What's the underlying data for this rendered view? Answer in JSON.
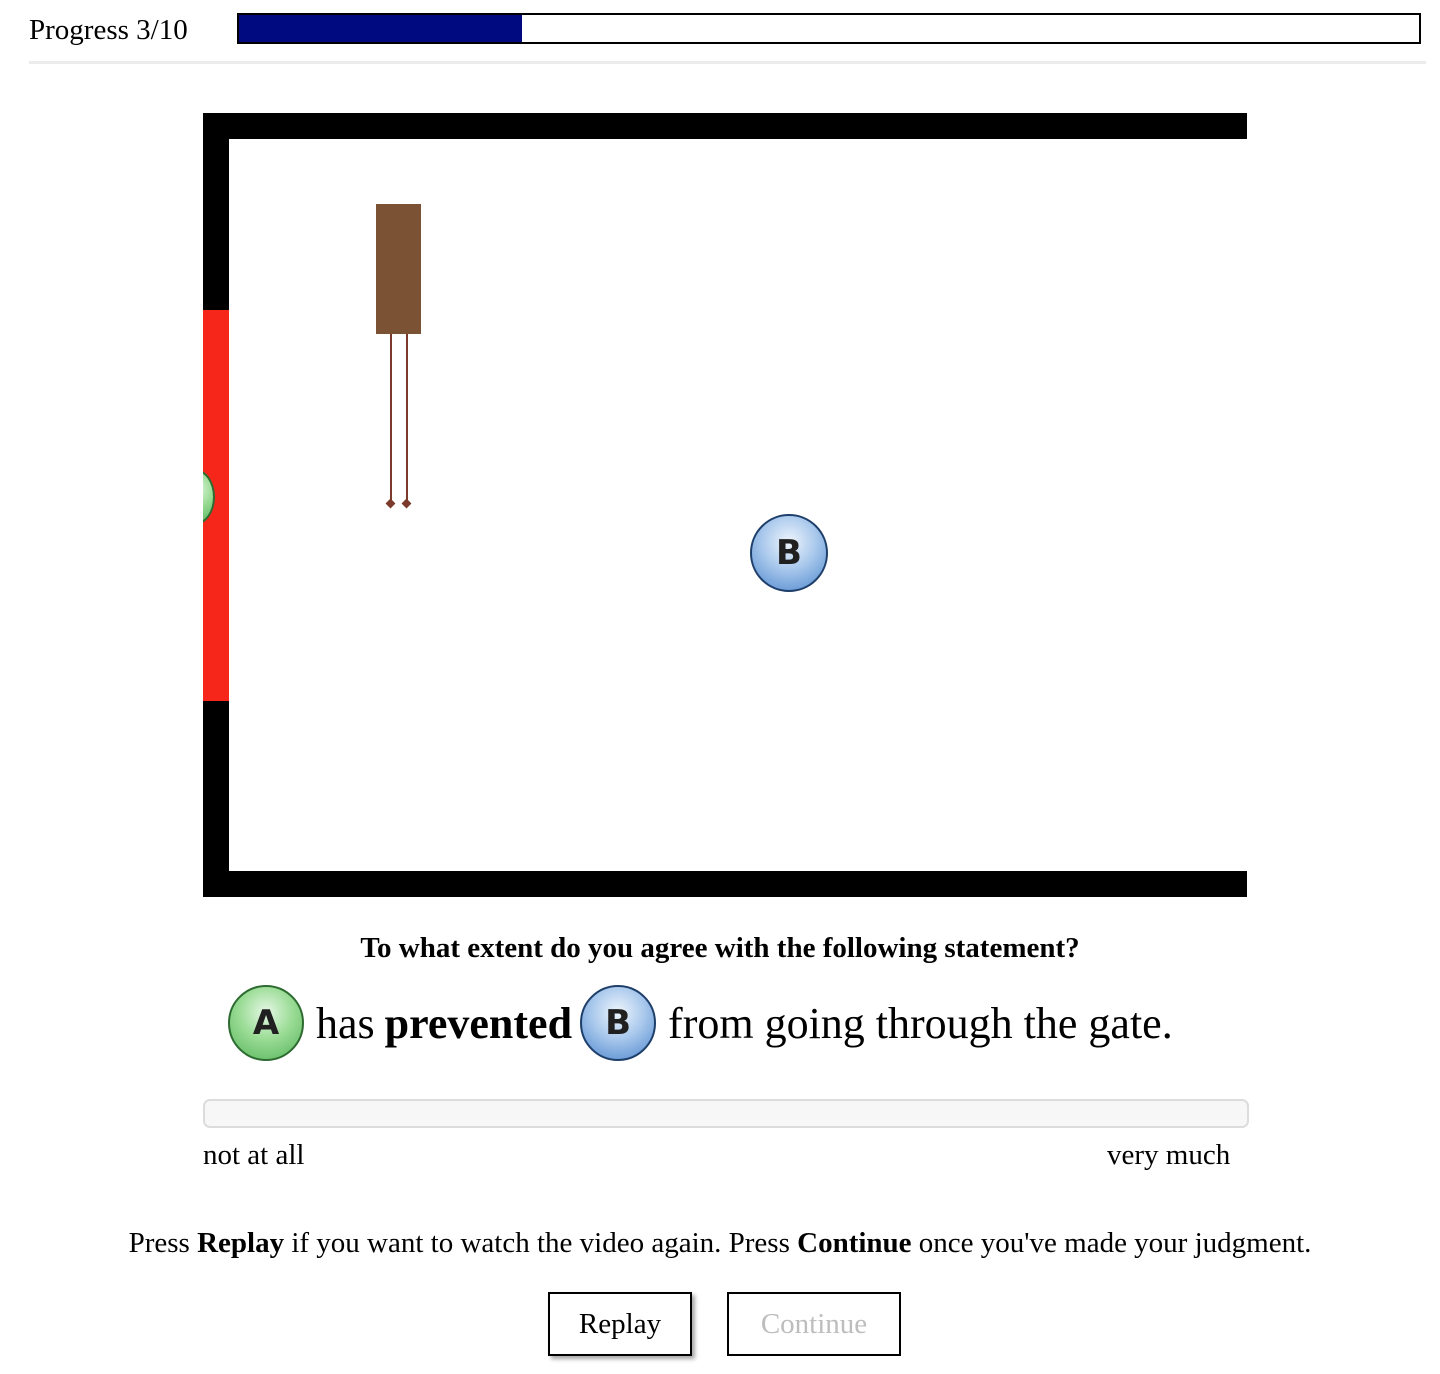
{
  "progress": {
    "label": "Progress 3/10",
    "current": 3,
    "total": 10,
    "fill_fraction": 0.24,
    "fill_color": "#000a80"
  },
  "stage": {
    "gate_color": "#f7261b",
    "ball_a_label": "A",
    "ball_b_label": "B",
    "box_color": "#7b5233"
  },
  "question": {
    "prompt": "To what extent do you agree with the following statement?",
    "statement": {
      "subject": "A",
      "has": "has",
      "verb": "prevented",
      "object": "B",
      "rest": "from going through the gate."
    }
  },
  "slider": {
    "min_label": "not at all",
    "max_label": "very much"
  },
  "instructions": {
    "part1": "Press ",
    "replay": "Replay",
    "part2": " if you want to watch the video again. Press ",
    "continue": "Continue",
    "part3": " once you've made your judgment."
  },
  "buttons": {
    "replay_label": "Replay",
    "continue_label": "Continue"
  }
}
